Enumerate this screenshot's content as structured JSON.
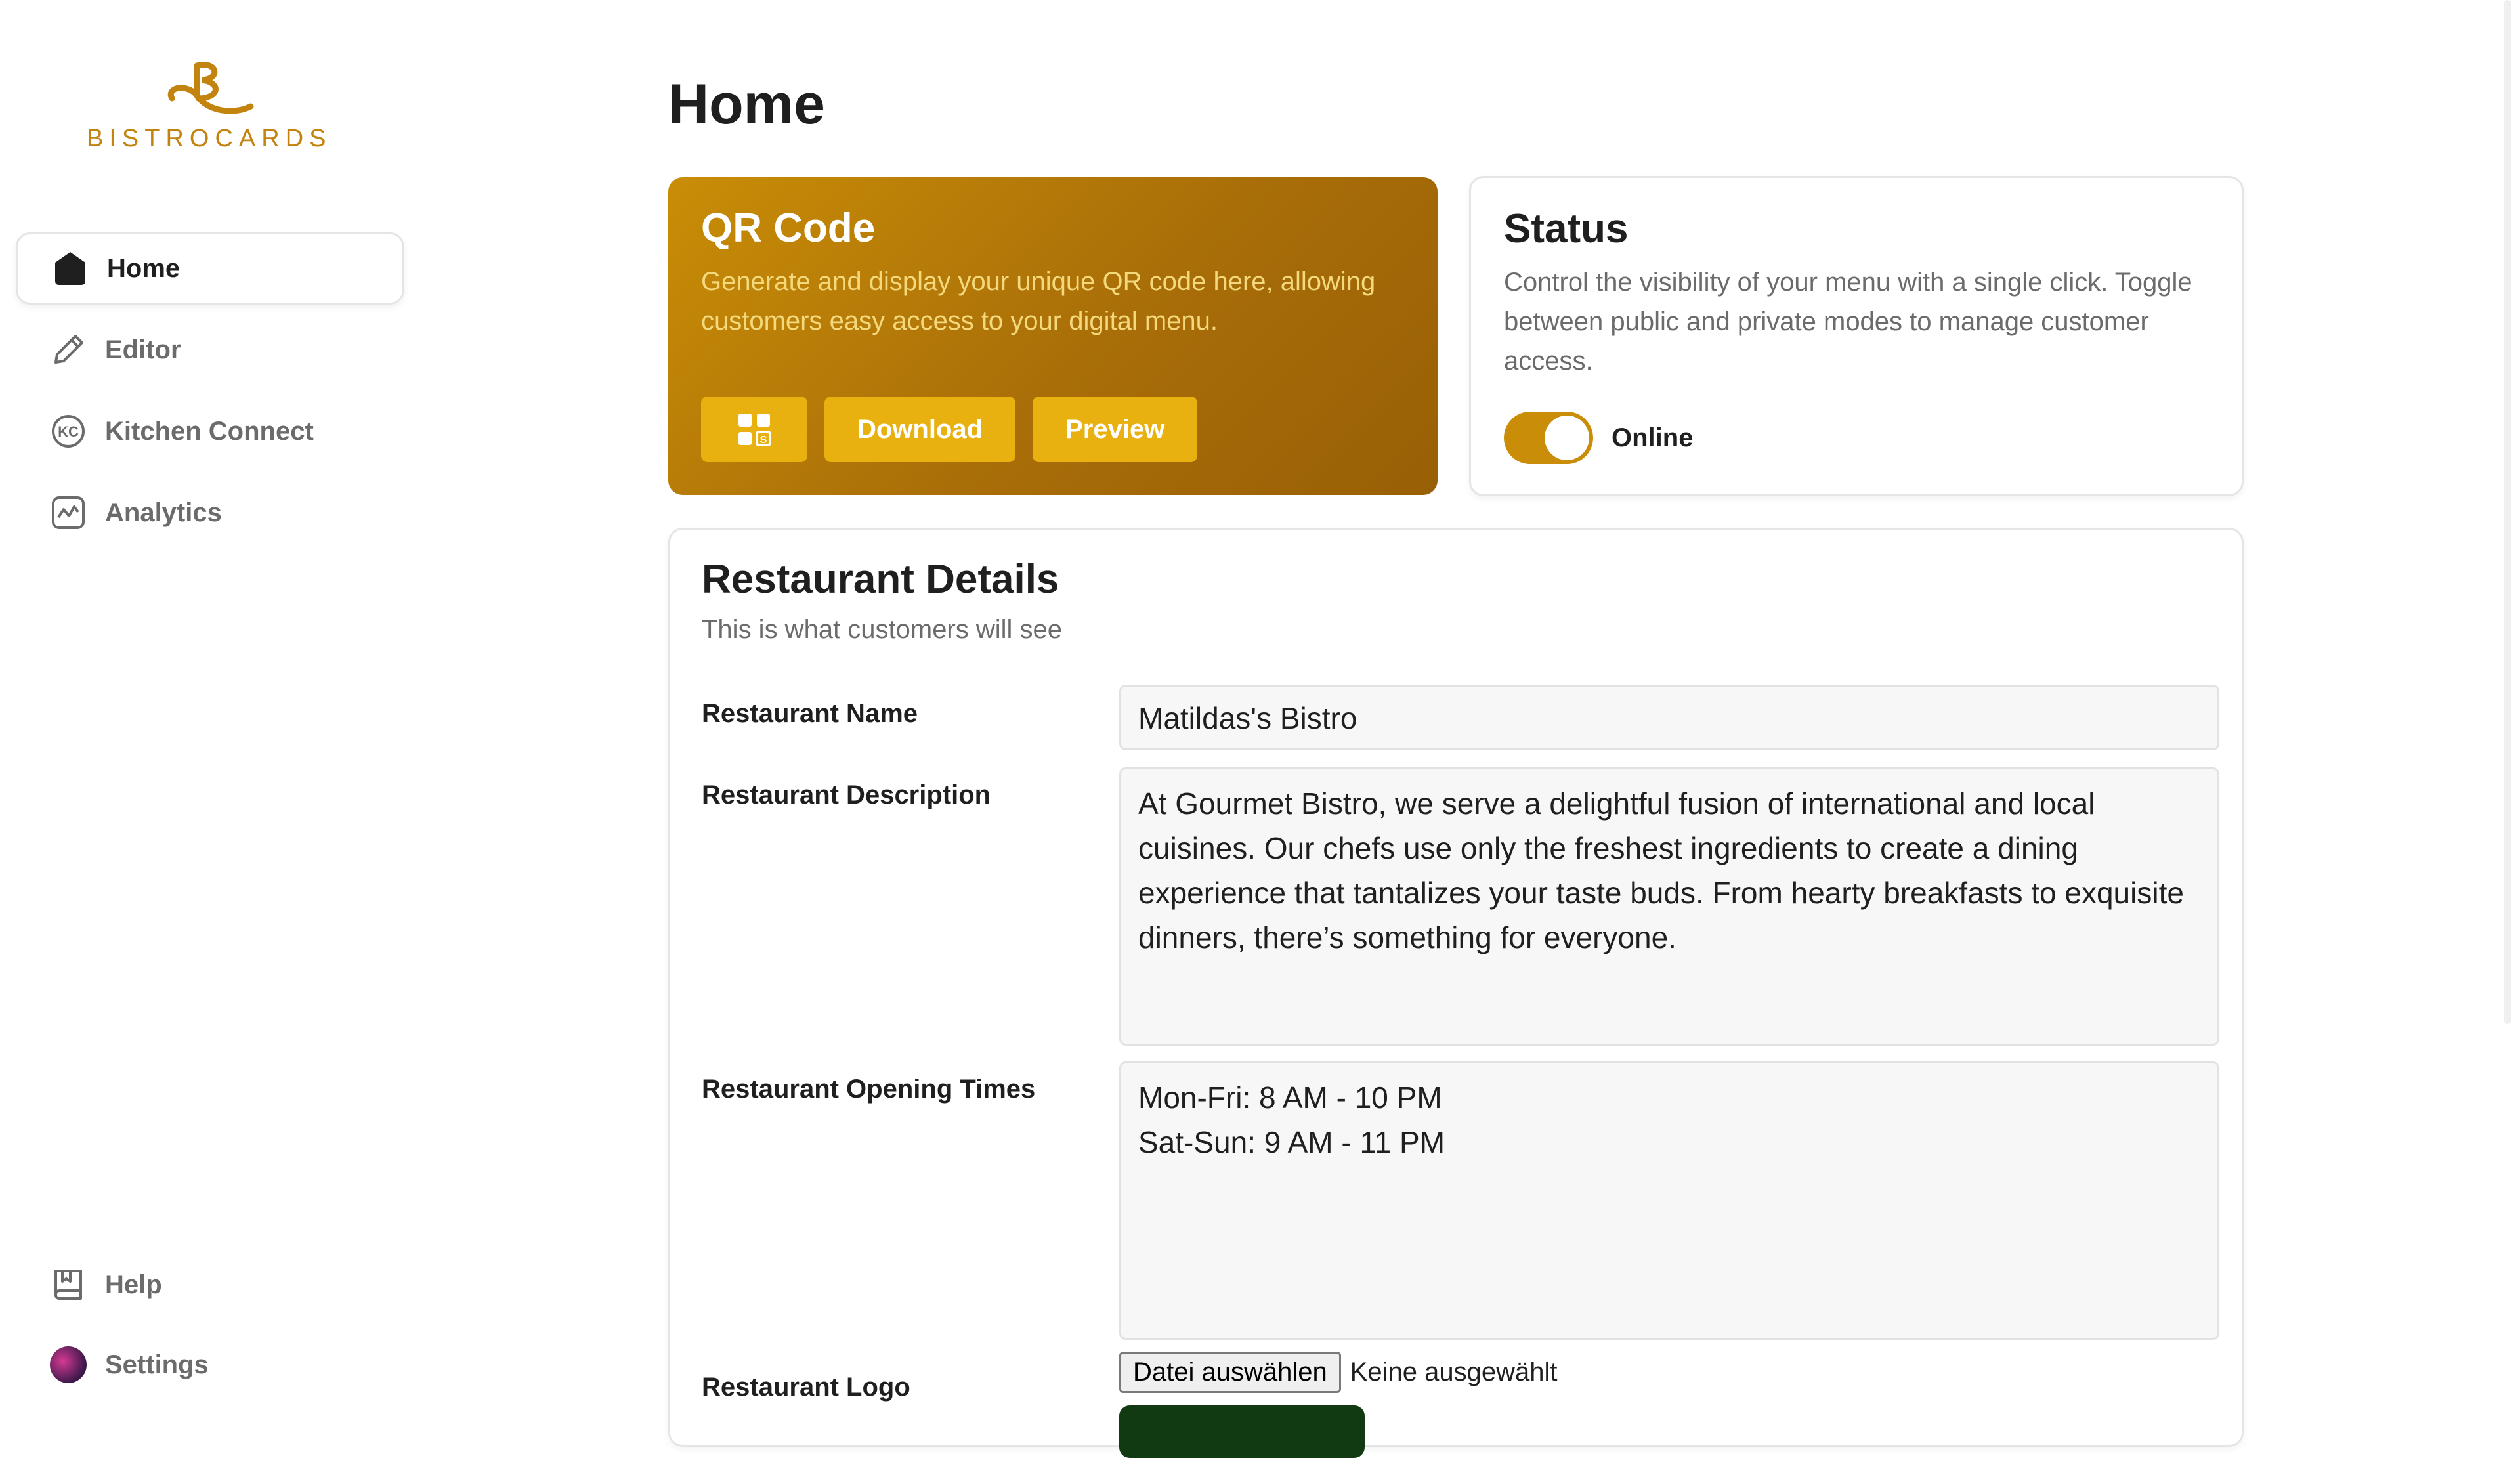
{
  "brand": {
    "name": "BISTROCARDS",
    "logo_icon": "bistrocards-logo-mark",
    "accent_color": "#c2840f"
  },
  "sidebar": {
    "items": [
      {
        "label": "Home",
        "icon": "home-icon",
        "active": true
      },
      {
        "label": "Editor",
        "icon": "pencil-icon"
      },
      {
        "label": "Kitchen Connect",
        "icon": "kitchen-connect-icon"
      },
      {
        "label": "Analytics",
        "icon": "analytics-icon"
      }
    ],
    "bottom_items": [
      {
        "label": "Help",
        "icon": "book-icon"
      },
      {
        "label": "Settings",
        "icon": "avatar"
      }
    ]
  },
  "page": {
    "title": "Home"
  },
  "qr_card": {
    "title": "QR Code",
    "description": "Generate and display your unique QR code here, allowing customers easy access to your digital menu.",
    "buttons": {
      "qr_icon": "qr-code-icon",
      "download": "Download",
      "preview": "Preview"
    }
  },
  "status_card": {
    "title": "Status",
    "description": "Control the visibility of your menu with a single click. Toggle between public and private modes to manage customer access.",
    "toggle_label": "Online",
    "toggle_on": true
  },
  "details": {
    "title": "Restaurant Details",
    "subtitle": "This is what customers will see",
    "fields": {
      "name_label": "Restaurant Name",
      "name_value": "Matildas's Bistro",
      "description_label": "Restaurant Description",
      "description_value": "At Gourmet Bistro, we serve a delightful fusion of international and local cuisines. Our chefs use only the freshest ingredients to create a dining experience that tantalizes your taste buds. From hearty breakfasts to exquisite dinners, there’s something for everyone.",
      "hours_label": "Restaurant Opening Times",
      "hours_value": "Mon-Fri: 8 AM - 10 PM\nSat-Sun: 9 AM - 11 PM",
      "logo_label": "Restaurant Logo",
      "file_button": "Datei auswählen",
      "file_status": "Keine ausgewählt"
    }
  }
}
